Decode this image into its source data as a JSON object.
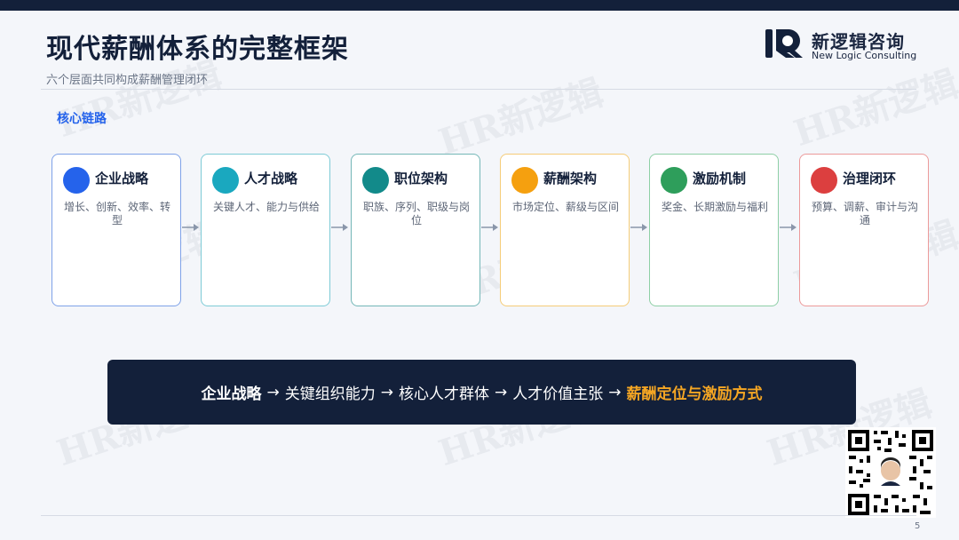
{
  "header": {
    "title": "现代薪酬体系的完整框架",
    "subtitle": "六个层面共同构成薪酬管理闭环"
  },
  "logo": {
    "name": "新逻辑咨询",
    "english": "New Logic Consulting"
  },
  "watermark_text": "HR新逻辑",
  "section": {
    "label": "核心链路"
  },
  "cards": [
    {
      "title": "企业战略",
      "desc": "增长、创新、效率、转型",
      "color": "#2563eb"
    },
    {
      "title": "人才战略",
      "desc": "关键人才、能力与供给",
      "color": "#1aa8bf"
    },
    {
      "title": "职位架构",
      "desc": "职族、序列、职级与岗位",
      "color": "#128a8a"
    },
    {
      "title": "薪酬架构",
      "desc": "市场定位、薪级与区间",
      "color": "#f5a00f"
    },
    {
      "title": "激励机制",
      "desc": "奖金、长期激励与福利",
      "color": "#2e9e5b"
    },
    {
      "title": "治理闭环",
      "desc": "预算、调薪、审计与沟通",
      "color": "#dc3f3f"
    }
  ],
  "banner": {
    "part1": "企业战略",
    "arrow": "→",
    "part2": "关键组织能力",
    "part3": "核心人才群体",
    "part4": "人才价值主张",
    "part5": "薪酬定位与激励方式"
  },
  "footer": {
    "page_number": "5"
  }
}
